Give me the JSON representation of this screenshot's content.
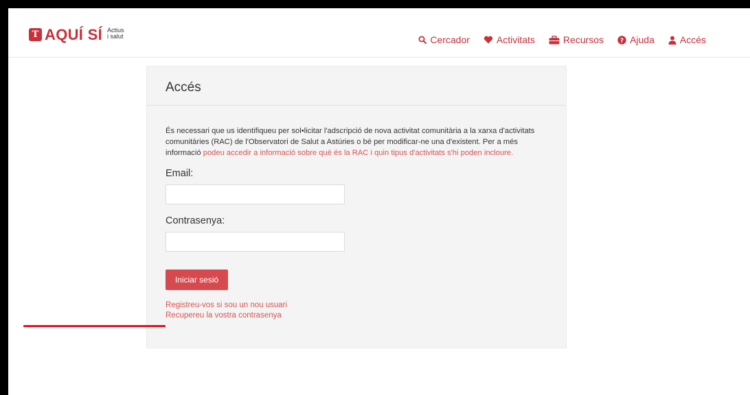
{
  "colors": {
    "brand_red": "#c9303a",
    "link_red": "#d9534f",
    "button_red": "#d64a4f",
    "annotation_red": "#e4101f"
  },
  "header": {
    "logo": {
      "mark": "T",
      "text": "AQUÍ SÍ",
      "sub_line1": "Actius",
      "sub_line2": "i salut"
    },
    "nav": [
      {
        "label": "Cercador",
        "icon": "search-icon"
      },
      {
        "label": "Activitats",
        "icon": "heart-icon"
      },
      {
        "label": "Recursos",
        "icon": "briefcase-icon"
      },
      {
        "label": "Ajuda",
        "icon": "question-circle-icon"
      },
      {
        "label": "Accés",
        "icon": "user-icon"
      }
    ]
  },
  "panel": {
    "title": "Accés",
    "intro_text": "És necessari que us identifiqueu per sol•licitar l'adscripció de nova activitat comunitària a la xarxa d'activitats comunitàries (RAC) de l'Observatori de Salut a Astúries o bé per modificar-ne una d'existent. Per a més informació ",
    "intro_link": "podeu accedir a informació sobre què és la RAC i quin tipus d'activitats s'hi poden incloure.",
    "email_label": "Email:",
    "email_value": "",
    "password_label": "Contrasenya:",
    "password_value": "",
    "login_button": "Iniciar sesió",
    "register_link": "Registreu-vos si sou un nou usuari",
    "recover_link": "Recupereu la vostra contrasenya"
  }
}
